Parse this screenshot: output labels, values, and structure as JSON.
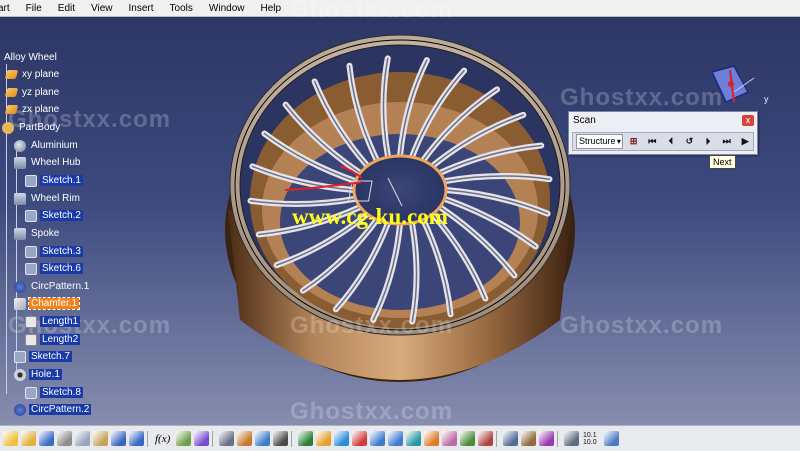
{
  "menu": [
    "art",
    "File",
    "Edit",
    "View",
    "Insert",
    "Tools",
    "Window",
    "Help"
  ],
  "watermarks": [
    "Ghostxx.com",
    "Ghostxx.com",
    "Ghostxx.com",
    "Ghostxx.com",
    "Ghostxx.com",
    "Ghostxx.com",
    "Ghostxx.com"
  ],
  "site_watermark": "www.cg-ku.com",
  "tree": {
    "root": "Alloy Wheel",
    "items": [
      {
        "label": "xy plane",
        "icon": "plane-icon"
      },
      {
        "label": "yz plane",
        "icon": "plane-icon"
      },
      {
        "label": "zx plane",
        "icon": "plane-icon"
      },
      {
        "label": "PartBody",
        "icon": "body-icon"
      },
      {
        "label": "Aluminium",
        "icon": "material-icon"
      },
      {
        "label": "Wheel Hub",
        "icon": "pad-icon"
      },
      {
        "label": "Sketch.1",
        "icon": "sketch-icon"
      },
      {
        "label": "Wheel Rim",
        "icon": "shaft-icon"
      },
      {
        "label": "Sketch.2",
        "icon": "sketch-icon"
      },
      {
        "label": "Spoke",
        "icon": "pad-icon"
      },
      {
        "label": "Sketch.3",
        "icon": "sketch-icon"
      },
      {
        "label": "Sketch.6",
        "icon": "sketch-icon"
      },
      {
        "label": "CircPattern.1",
        "icon": "circpattern-icon"
      },
      {
        "label": "Chamfer.1",
        "icon": "chamfer-icon"
      },
      {
        "label": "Length1",
        "icon": "parameter-icon"
      },
      {
        "label": "Length2",
        "icon": "parameter-icon"
      },
      {
        "label": "Sketch.7",
        "icon": "sketch-icon"
      },
      {
        "label": "Hole.1",
        "icon": "hole-icon"
      },
      {
        "label": "Sketch.8",
        "icon": "sketch-icon"
      },
      {
        "label": "CircPattern.2",
        "icon": "circpattern-icon"
      }
    ]
  },
  "scan": {
    "title": "Scan",
    "close": "x",
    "mode": "Structure",
    "buttons": [
      "first-icon",
      "previous-icon",
      "step-back-icon",
      "next-icon",
      "last-icon",
      "play-icon"
    ],
    "tooltip": "Next"
  },
  "compass": {
    "axis_y": "y"
  },
  "bottom_toolbar": {
    "fx": "f(x)",
    "zoom_values": [
      "10.1",
      "10.0"
    ]
  },
  "colors": {
    "background_top": "#2b3563",
    "background_bottom": "#8f95b4",
    "wheel": "#a0744a",
    "selection": "#1a3aa8",
    "highlight": "#f2821b",
    "site_watermark": "#ffff1a"
  }
}
